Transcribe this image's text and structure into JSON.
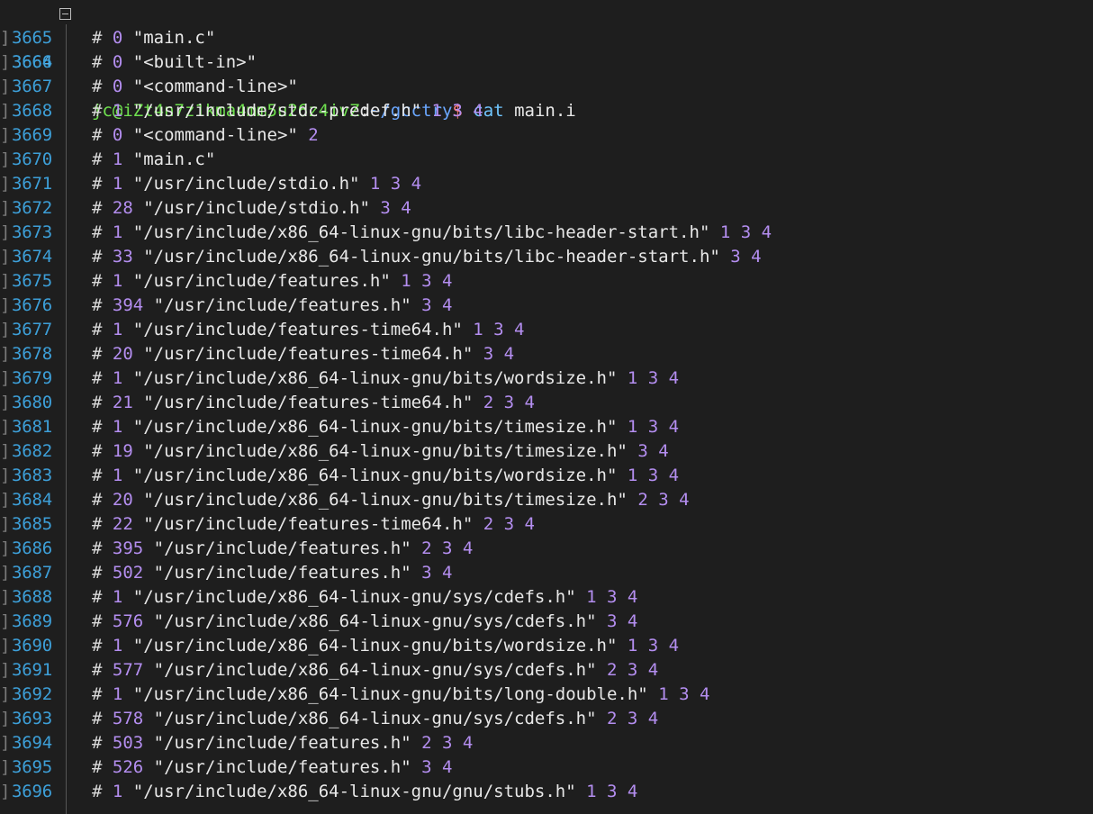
{
  "prompt": {
    "line_number": "3664",
    "user_host": "jc@iZt4n7z1kma4mm5u26z4ivZ",
    "separator": ":",
    "path": "~/gcctry",
    "dollar": "$",
    "command": "cat",
    "argument": "main.i"
  },
  "lines": [
    {
      "n": "3665",
      "level": "0",
      "file": "\"main.c\"",
      "flags": ""
    },
    {
      "n": "3666",
      "level": "0",
      "file": "\"<built-in>\"",
      "flags": ""
    },
    {
      "n": "3667",
      "level": "0",
      "file": "\"<command-line>\"",
      "flags": ""
    },
    {
      "n": "3668",
      "level": "1",
      "file": "\"/usr/include/stdc-predef.h\"",
      "flags": "1 3 4"
    },
    {
      "n": "3669",
      "level": "0",
      "file": "\"<command-line>\"",
      "flags": "2"
    },
    {
      "n": "3670",
      "level": "1",
      "file": "\"main.c\"",
      "flags": ""
    },
    {
      "n": "3671",
      "level": "1",
      "file": "\"/usr/include/stdio.h\"",
      "flags": "1 3 4"
    },
    {
      "n": "3672",
      "level": "28",
      "file": "\"/usr/include/stdio.h\"",
      "flags": "3 4"
    },
    {
      "n": "3673",
      "level": "1",
      "file": "\"/usr/include/x86_64-linux-gnu/bits/libc-header-start.h\"",
      "flags": "1 3 4"
    },
    {
      "n": "3674",
      "level": "33",
      "file": "\"/usr/include/x86_64-linux-gnu/bits/libc-header-start.h\"",
      "flags": "3 4"
    },
    {
      "n": "3675",
      "level": "1",
      "file": "\"/usr/include/features.h\"",
      "flags": "1 3 4"
    },
    {
      "n": "3676",
      "level": "394",
      "file": "\"/usr/include/features.h\"",
      "flags": "3 4"
    },
    {
      "n": "3677",
      "level": "1",
      "file": "\"/usr/include/features-time64.h\"",
      "flags": "1 3 4"
    },
    {
      "n": "3678",
      "level": "20",
      "file": "\"/usr/include/features-time64.h\"",
      "flags": "3 4"
    },
    {
      "n": "3679",
      "level": "1",
      "file": "\"/usr/include/x86_64-linux-gnu/bits/wordsize.h\"",
      "flags": "1 3 4"
    },
    {
      "n": "3680",
      "level": "21",
      "file": "\"/usr/include/features-time64.h\"",
      "flags": "2 3 4"
    },
    {
      "n": "3681",
      "level": "1",
      "file": "\"/usr/include/x86_64-linux-gnu/bits/timesize.h\"",
      "flags": "1 3 4"
    },
    {
      "n": "3682",
      "level": "19",
      "file": "\"/usr/include/x86_64-linux-gnu/bits/timesize.h\"",
      "flags": "3 4"
    },
    {
      "n": "3683",
      "level": "1",
      "file": "\"/usr/include/x86_64-linux-gnu/bits/wordsize.h\"",
      "flags": "1 3 4"
    },
    {
      "n": "3684",
      "level": "20",
      "file": "\"/usr/include/x86_64-linux-gnu/bits/timesize.h\"",
      "flags": "2 3 4"
    },
    {
      "n": "3685",
      "level": "22",
      "file": "\"/usr/include/features-time64.h\"",
      "flags": "2 3 4"
    },
    {
      "n": "3686",
      "level": "395",
      "file": "\"/usr/include/features.h\"",
      "flags": "2 3 4"
    },
    {
      "n": "3687",
      "level": "502",
      "file": "\"/usr/include/features.h\"",
      "flags": "3 4"
    },
    {
      "n": "3688",
      "level": "1",
      "file": "\"/usr/include/x86_64-linux-gnu/sys/cdefs.h\"",
      "flags": "1 3 4"
    },
    {
      "n": "3689",
      "level": "576",
      "file": "\"/usr/include/x86_64-linux-gnu/sys/cdefs.h\"",
      "flags": "3 4"
    },
    {
      "n": "3690",
      "level": "1",
      "file": "\"/usr/include/x86_64-linux-gnu/bits/wordsize.h\"",
      "flags": "1 3 4"
    },
    {
      "n": "3691",
      "level": "577",
      "file": "\"/usr/include/x86_64-linux-gnu/sys/cdefs.h\"",
      "flags": "2 3 4"
    },
    {
      "n": "3692",
      "level": "1",
      "file": "\"/usr/include/x86_64-linux-gnu/bits/long-double.h\"",
      "flags": "1 3 4"
    },
    {
      "n": "3693",
      "level": "578",
      "file": "\"/usr/include/x86_64-linux-gnu/sys/cdefs.h\"",
      "flags": "2 3 4"
    },
    {
      "n": "3694",
      "level": "503",
      "file": "\"/usr/include/features.h\"",
      "flags": "2 3 4"
    },
    {
      "n": "3695",
      "level": "526",
      "file": "\"/usr/include/features.h\"",
      "flags": "3 4"
    },
    {
      "n": "3696",
      "level": "1",
      "file": "\"/usr/include/x86_64-linux-gnu/gnu/stubs.h\"",
      "flags": "1 3 4"
    }
  ],
  "colors": {
    "background": "#1e1e1e",
    "line_number": "#3d9fd8",
    "prompt_user": "#6fe04f",
    "prompt_path": "#6aa7ff",
    "prompt_dollar": "#ff7a7a",
    "command": "#70c6ff",
    "number": "#b48ef0",
    "text": "#d8d8d8"
  }
}
